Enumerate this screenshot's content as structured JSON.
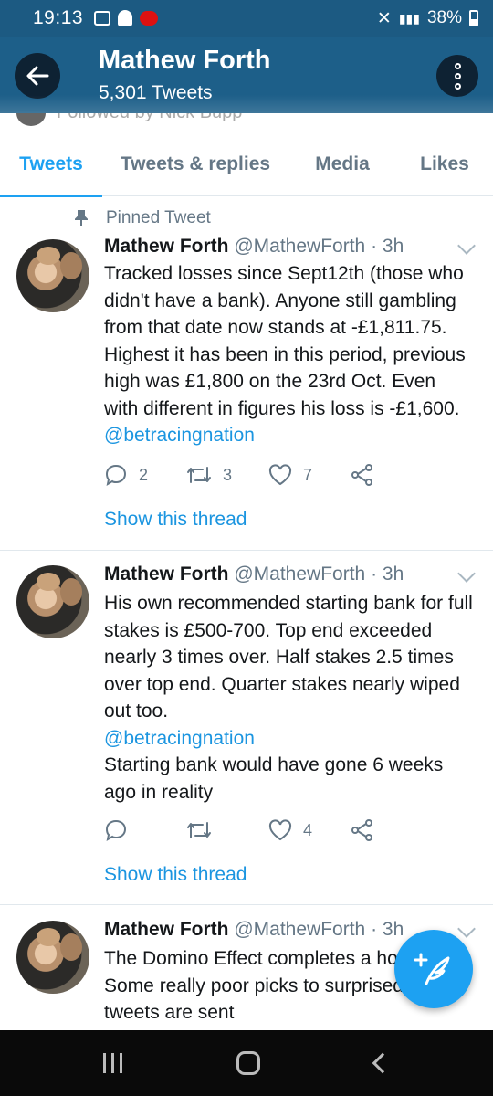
{
  "status_bar": {
    "time": "19:13",
    "battery": "38%",
    "signal": "4G"
  },
  "header": {
    "title": "Mathew Forth",
    "subtitle": "5,301 Tweets"
  },
  "followed_strip": {
    "text": "Followed by Nick Bupp"
  },
  "tabs": [
    {
      "label": "Tweets",
      "active": true
    },
    {
      "label": "Tweets & replies",
      "active": false
    },
    {
      "label": "Media",
      "active": false
    },
    {
      "label": "Likes",
      "active": false
    }
  ],
  "tweets": [
    {
      "pinned_label": "Pinned Tweet",
      "name": "Mathew Forth",
      "handle": "@MathewForth",
      "time": "· 3h",
      "text": "Tracked losses since Sept12th (those who didn't have a bank). Anyone still gambling from that date now stands at -£1,811.75. Highest it has been in this period, previous high was £1,800 on the 23rd Oct. Even with different in figures his loss is -£1,600.",
      "mention": "@betracingnation",
      "text_after": "",
      "replies": "2",
      "retweets": "3",
      "likes": "7",
      "show_thread": "Show this thread"
    },
    {
      "name": "Mathew Forth",
      "handle": "@MathewForth",
      "time": "· 3h",
      "text": "His own recommended starting bank for full stakes is £500-700. Top end exceeded nearly 3 times over. Half stakes 2.5 times over top end. Quarter stakes nearly wiped out too.",
      "mention": "@betracingnation",
      "text_after": "Starting bank would have gone 6 weeks ago in reality",
      "replies": "",
      "retweets": "",
      "likes": "4",
      "show_thread": "Show this thread"
    },
    {
      "name": "Mathew Forth",
      "handle": "@MathewForth",
      "time": "· 3h",
      "text": "The Domino Effect completes a house. Some really poor picks to surprised if any tweets are sent"
    }
  ],
  "colors": {
    "accent": "#1da1f2",
    "header_bg": "#1d5f89",
    "mention": "#1b95e0"
  }
}
